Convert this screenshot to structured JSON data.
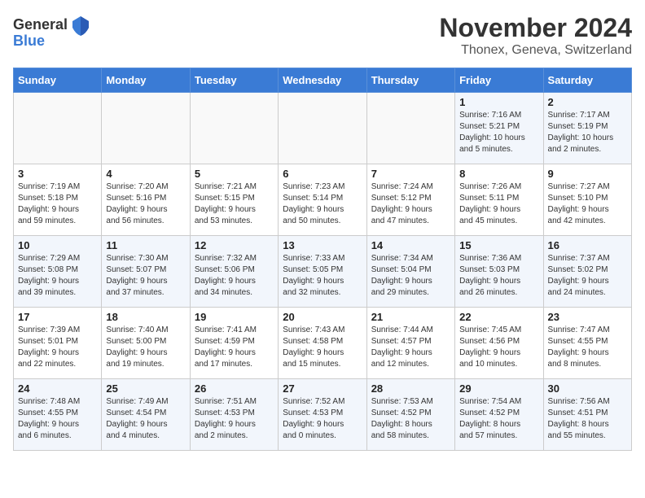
{
  "header": {
    "logo_general": "General",
    "logo_blue": "Blue",
    "month": "November 2024",
    "location": "Thonex, Geneva, Switzerland"
  },
  "weekdays": [
    "Sunday",
    "Monday",
    "Tuesday",
    "Wednesday",
    "Thursday",
    "Friday",
    "Saturday"
  ],
  "weeks": [
    [
      {
        "day": "",
        "info": ""
      },
      {
        "day": "",
        "info": ""
      },
      {
        "day": "",
        "info": ""
      },
      {
        "day": "",
        "info": ""
      },
      {
        "day": "",
        "info": ""
      },
      {
        "day": "1",
        "info": "Sunrise: 7:16 AM\nSunset: 5:21 PM\nDaylight: 10 hours\nand 5 minutes."
      },
      {
        "day": "2",
        "info": "Sunrise: 7:17 AM\nSunset: 5:19 PM\nDaylight: 10 hours\nand 2 minutes."
      }
    ],
    [
      {
        "day": "3",
        "info": "Sunrise: 7:19 AM\nSunset: 5:18 PM\nDaylight: 9 hours\nand 59 minutes."
      },
      {
        "day": "4",
        "info": "Sunrise: 7:20 AM\nSunset: 5:16 PM\nDaylight: 9 hours\nand 56 minutes."
      },
      {
        "day": "5",
        "info": "Sunrise: 7:21 AM\nSunset: 5:15 PM\nDaylight: 9 hours\nand 53 minutes."
      },
      {
        "day": "6",
        "info": "Sunrise: 7:23 AM\nSunset: 5:14 PM\nDaylight: 9 hours\nand 50 minutes."
      },
      {
        "day": "7",
        "info": "Sunrise: 7:24 AM\nSunset: 5:12 PM\nDaylight: 9 hours\nand 47 minutes."
      },
      {
        "day": "8",
        "info": "Sunrise: 7:26 AM\nSunset: 5:11 PM\nDaylight: 9 hours\nand 45 minutes."
      },
      {
        "day": "9",
        "info": "Sunrise: 7:27 AM\nSunset: 5:10 PM\nDaylight: 9 hours\nand 42 minutes."
      }
    ],
    [
      {
        "day": "10",
        "info": "Sunrise: 7:29 AM\nSunset: 5:08 PM\nDaylight: 9 hours\nand 39 minutes."
      },
      {
        "day": "11",
        "info": "Sunrise: 7:30 AM\nSunset: 5:07 PM\nDaylight: 9 hours\nand 37 minutes."
      },
      {
        "day": "12",
        "info": "Sunrise: 7:32 AM\nSunset: 5:06 PM\nDaylight: 9 hours\nand 34 minutes."
      },
      {
        "day": "13",
        "info": "Sunrise: 7:33 AM\nSunset: 5:05 PM\nDaylight: 9 hours\nand 32 minutes."
      },
      {
        "day": "14",
        "info": "Sunrise: 7:34 AM\nSunset: 5:04 PM\nDaylight: 9 hours\nand 29 minutes."
      },
      {
        "day": "15",
        "info": "Sunrise: 7:36 AM\nSunset: 5:03 PM\nDaylight: 9 hours\nand 26 minutes."
      },
      {
        "day": "16",
        "info": "Sunrise: 7:37 AM\nSunset: 5:02 PM\nDaylight: 9 hours\nand 24 minutes."
      }
    ],
    [
      {
        "day": "17",
        "info": "Sunrise: 7:39 AM\nSunset: 5:01 PM\nDaylight: 9 hours\nand 22 minutes."
      },
      {
        "day": "18",
        "info": "Sunrise: 7:40 AM\nSunset: 5:00 PM\nDaylight: 9 hours\nand 19 minutes."
      },
      {
        "day": "19",
        "info": "Sunrise: 7:41 AM\nSunset: 4:59 PM\nDaylight: 9 hours\nand 17 minutes."
      },
      {
        "day": "20",
        "info": "Sunrise: 7:43 AM\nSunset: 4:58 PM\nDaylight: 9 hours\nand 15 minutes."
      },
      {
        "day": "21",
        "info": "Sunrise: 7:44 AM\nSunset: 4:57 PM\nDaylight: 9 hours\nand 12 minutes."
      },
      {
        "day": "22",
        "info": "Sunrise: 7:45 AM\nSunset: 4:56 PM\nDaylight: 9 hours\nand 10 minutes."
      },
      {
        "day": "23",
        "info": "Sunrise: 7:47 AM\nSunset: 4:55 PM\nDaylight: 9 hours\nand 8 minutes."
      }
    ],
    [
      {
        "day": "24",
        "info": "Sunrise: 7:48 AM\nSunset: 4:55 PM\nDaylight: 9 hours\nand 6 minutes."
      },
      {
        "day": "25",
        "info": "Sunrise: 7:49 AM\nSunset: 4:54 PM\nDaylight: 9 hours\nand 4 minutes."
      },
      {
        "day": "26",
        "info": "Sunrise: 7:51 AM\nSunset: 4:53 PM\nDaylight: 9 hours\nand 2 minutes."
      },
      {
        "day": "27",
        "info": "Sunrise: 7:52 AM\nSunset: 4:53 PM\nDaylight: 9 hours\nand 0 minutes."
      },
      {
        "day": "28",
        "info": "Sunrise: 7:53 AM\nSunset: 4:52 PM\nDaylight: 8 hours\nand 58 minutes."
      },
      {
        "day": "29",
        "info": "Sunrise: 7:54 AM\nSunset: 4:52 PM\nDaylight: 8 hours\nand 57 minutes."
      },
      {
        "day": "30",
        "info": "Sunrise: 7:56 AM\nSunset: 4:51 PM\nDaylight: 8 hours\nand 55 minutes."
      }
    ]
  ]
}
